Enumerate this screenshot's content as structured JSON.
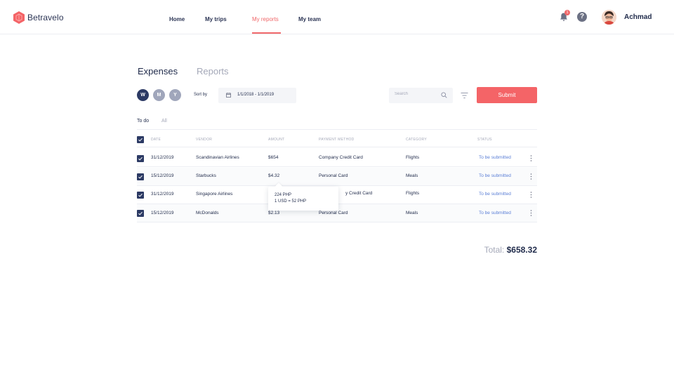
{
  "brand": {
    "name": "Betravelo"
  },
  "nav": {
    "links": [
      {
        "label": "Home"
      },
      {
        "label": "My trips"
      },
      {
        "label": "My reports"
      },
      {
        "label": "My team"
      }
    ]
  },
  "user": {
    "name": "Achmad",
    "notification_count": "1",
    "help_glyph": "?"
  },
  "tabs": {
    "expenses": "Expenses",
    "reports": "Reports"
  },
  "filters": {
    "chips": [
      "W",
      "M",
      "Y"
    ],
    "sort_label": "Sort by",
    "date_range": "1/1/2018 - 1/1/2019",
    "search_placeholder": "Search",
    "submit_label": "Submit"
  },
  "subtabs": {
    "todo": "To do",
    "all": "All"
  },
  "table": {
    "headers": {
      "date": "DATE",
      "vendor": "VENDOR",
      "amount": "AMOUNT",
      "payment": "PAYMENT METHOD",
      "category": "CATEGORY",
      "status": "STATUS"
    },
    "rows": [
      {
        "date": "31/12/2019",
        "vendor": "Scandinavian Airlines",
        "amount": "$654",
        "payment": "Company Credit Card",
        "category": "Flights",
        "status": "To be submitted"
      },
      {
        "date": "15/12/2019",
        "vendor": "Starbucks",
        "amount": "$4.32",
        "payment": "Personal Card",
        "category": "Meals",
        "status": "To be submitted"
      },
      {
        "date": "31/12/2019",
        "vendor": "Singapore Airlines",
        "amount": "",
        "payment": "y Credit Card",
        "category": "Flights",
        "status": "To be submitted"
      },
      {
        "date": "15/12/2019",
        "vendor": "McDonalds",
        "amount": "$2.13",
        "payment": "Personal Card",
        "category": "Meals",
        "status": "To be submitted"
      }
    ]
  },
  "tooltip": {
    "line1": "224 PHP",
    "line2": "1 USD = 52 PHP"
  },
  "total": {
    "label": "Total:",
    "value": "$658.32"
  },
  "colors": {
    "accent": "#f46467",
    "navy": "#2c3a64",
    "status": "#5b7fd6",
    "muted": "#a4a8b8"
  }
}
